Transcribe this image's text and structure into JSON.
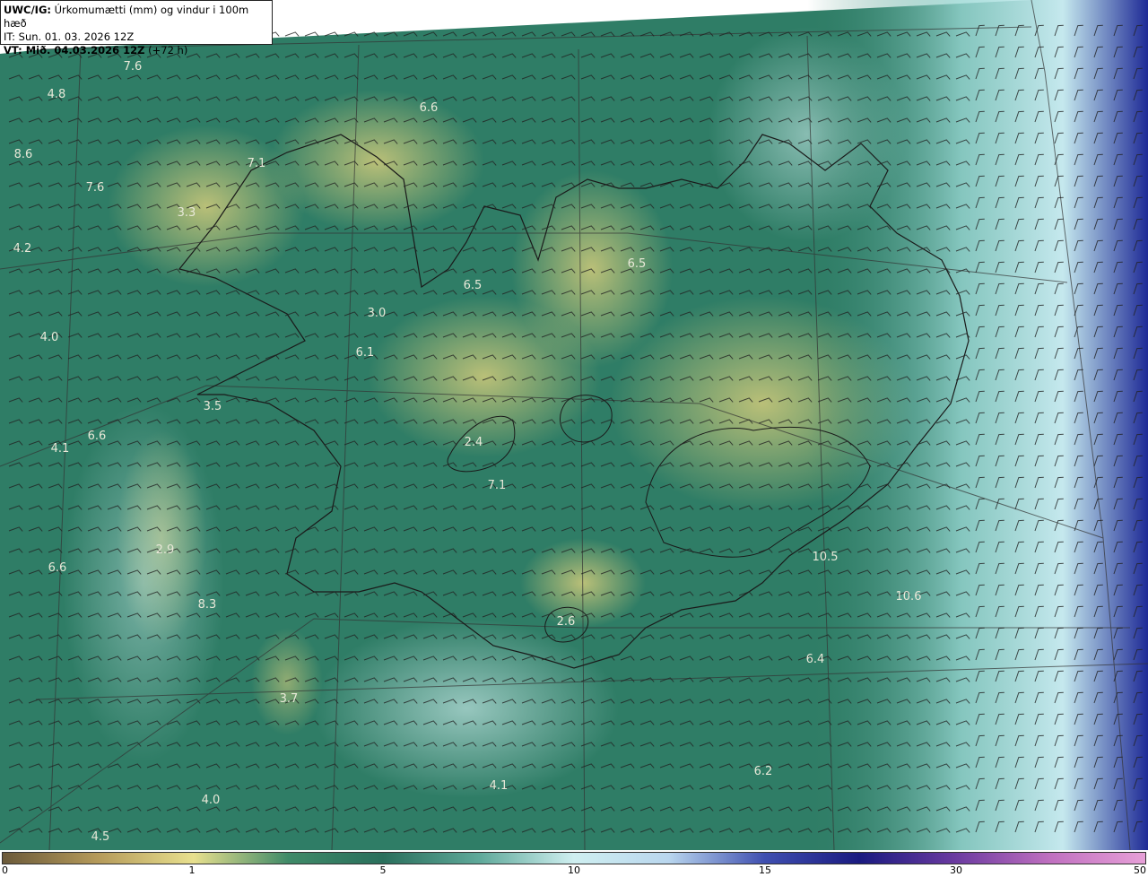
{
  "header": {
    "model": "UWC/IG:",
    "title": "Úrkomumætti (mm) og vindur i 100m hæð",
    "issue_time": "IT: Sun. 01. 03. 2026 12Z",
    "valid_prefix": "VT: Mið. 04.03.2026 12Z",
    "valid_suffix": " (+72 h)"
  },
  "colorbar": {
    "ticks": [
      "0",
      "1",
      "5",
      "10",
      "15",
      "30",
      "50"
    ],
    "colors": [
      "#6b5a3a",
      "#b59a5a",
      "#e8e08e",
      "#3f8a68",
      "#2a6f5c",
      "#5fa99a",
      "#cfeff0",
      "#b9d6ee",
      "#3f4fb0",
      "#1a1a80",
      "#6a3aa0",
      "#c070c0",
      "#e7a0d8"
    ]
  },
  "map_labels": [
    {
      "text": "7.6"
    },
    {
      "text": "4.8"
    },
    {
      "text": "6.6"
    },
    {
      "text": "8.6"
    },
    {
      "text": "7.1"
    },
    {
      "text": "7.6"
    },
    {
      "text": "3.3"
    },
    {
      "text": "4.2"
    },
    {
      "text": "6.5"
    },
    {
      "text": "6.5"
    },
    {
      "text": "3.0"
    },
    {
      "text": "4.0"
    },
    {
      "text": "6.1"
    },
    {
      "text": "3.5"
    },
    {
      "text": "4.1"
    },
    {
      "text": "6.6"
    },
    {
      "text": "2.4"
    },
    {
      "text": "7.1"
    },
    {
      "text": "2.9"
    },
    {
      "text": "6.6"
    },
    {
      "text": "8.3"
    },
    {
      "text": "2.6"
    },
    {
      "text": "10.5"
    },
    {
      "text": "10.6"
    },
    {
      "text": "6.4"
    },
    {
      "text": "3.7"
    },
    {
      "text": "6.2"
    },
    {
      "text": "4.1"
    },
    {
      "text": "4.0"
    },
    {
      "text": "4.5"
    }
  ]
}
